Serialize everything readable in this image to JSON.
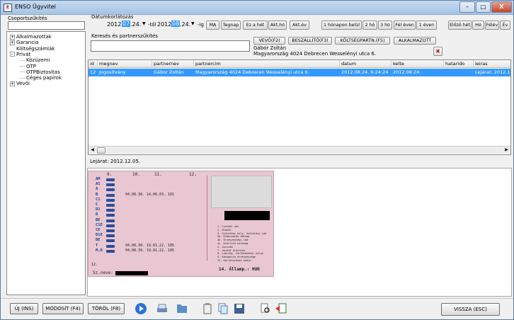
{
  "window": {
    "title": "ENSO Ügyvitel",
    "minimize": "–",
    "maximize": "□",
    "close": "X"
  },
  "left": {
    "header": "Csoportszűkítés",
    "tree": [
      {
        "label": "Alkalmazottak",
        "expander": "+",
        "level": 0
      },
      {
        "label": "Garancia",
        "expander": "+",
        "level": 0
      },
      {
        "label": "Költségszámlák",
        "expander": "",
        "level": 0
      },
      {
        "label": "Privát",
        "expander": "–",
        "level": 0
      },
      {
        "label": "Közüzemi",
        "expander": "",
        "level": 1
      },
      {
        "label": "OTP",
        "expander": "",
        "level": 1
      },
      {
        "label": "OTPBiztositas",
        "expander": "",
        "level": 1
      },
      {
        "label": "Céges papírok",
        "expander": "",
        "level": 1
      },
      {
        "label": "Vevői",
        "expander": "+",
        "level": 0
      }
    ]
  },
  "date": {
    "label": "Dátumkorlátozás",
    "from": {
      "y": "2012.",
      "m": "07",
      "d": ".24.",
      "suffix": "-től"
    },
    "to": {
      "y": "2012.",
      "m": "08",
      "d": ".24.",
      "suffix": "-ig"
    },
    "buttons": [
      "MA",
      "Tegnap",
      "Ez a hét",
      "Akt.hó",
      "Akt.év"
    ],
    "range_buttons": [
      "1 hónapon belül",
      "2 hó",
      "3 hó",
      "Fél éven",
      "1 éven"
    ],
    "prev_buttons": [
      "Előző hét",
      "Hó",
      "Félév",
      "Év"
    ]
  },
  "search": {
    "label": "Keresés és partnerszűkítés",
    "value": "",
    "partner_buttons": [
      "VEVŐ(F2)",
      "BESZÁLLÍTÓ(F3)",
      "KÖLTSÉGPARTN.(F5)",
      "ALKALMAZOTT"
    ],
    "partner_name": "Gábor Zoltán",
    "partner_address": "Magyarország 4024 Debrecen Wesselényi utca 6."
  },
  "table": {
    "columns": [
      "id",
      "megnev",
      "partnernev",
      "partnercim",
      "datum",
      "kelte",
      "hatarido",
      "leiras"
    ],
    "rows": [
      {
        "id": "12",
        "megnev": "Jogosítvány",
        "partnernev": "Gábor Zoltán",
        "partnercim": "Magyarország 4024 Debrecen Wesselényi utca 6.",
        "datum": "2012.08.24. 6:24:24",
        "kelte": "2012.08.24.",
        "hatarido": "",
        "leiras": "Lejárat: 2012.1"
      }
    ]
  },
  "detail": {
    "text": "Lejárat: 2012.12.05."
  },
  "license": {
    "col_headers": [
      "9.",
      "10.",
      "11.",
      "12."
    ],
    "categories": [
      "AM",
      "A1",
      "A",
      "B",
      "C1",
      "C",
      "D1",
      "D",
      "BE",
      "C1E",
      "CE",
      "D1E",
      "DE",
      "T",
      "M,K"
    ],
    "rows": [
      {
        "cat": "B",
        "d10": "94.08.30.",
        "d11": "14.06.03.",
        "d12": "101"
      },
      {
        "cat": "T",
        "d10": "94.08.30.",
        "d11": "19.01.22.",
        "d12": "185"
      },
      {
        "cat": "M,K",
        "d10": "94.08.30.",
        "d11": "19.01.22.",
        "d12": "185"
      }
    ],
    "name_label": "Sz.neve:",
    "row12": "12.",
    "legend": [
      "1. Családi név",
      "2. Utónév",
      "3. Születési hely, Születési idő",
      "4a. Kibocsátás dátuma",
      "4b. Érvényességi idő",
      "4c. Kiállító hatóság",
      "5. Sorszám",
      "7. Vezető aláírása",
      "8. Lakcíme, tartózkodási helye",
      "9. Kategória érvényessége",
      "12. Korlátozások kódja"
    ],
    "citizenship": "14. Államp.: HUN"
  },
  "bottom": {
    "new": "ÚJ (INS)",
    "modify": "MÓDOSÍT (F4)",
    "delete": "TÖRÖL (F8)",
    "back": "VISSZA (ESC)"
  }
}
